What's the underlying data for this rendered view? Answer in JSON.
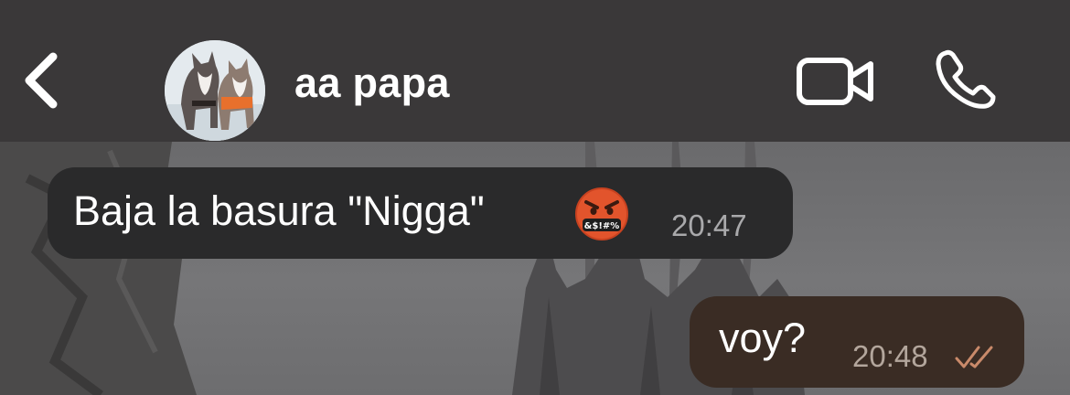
{
  "header": {
    "contact_name": "aa papa",
    "back_icon": "chevron-left-icon",
    "video_icon": "video-camera-icon",
    "call_icon": "phone-icon",
    "avatar_description": "husky dogs profile photo"
  },
  "messages": [
    {
      "direction": "incoming",
      "text": "Baja la basura \"Nigga\"",
      "emoji": "face-with-symbols-on-mouth",
      "time": "20:47"
    },
    {
      "direction": "outgoing",
      "text": "voy?",
      "time": "20:48",
      "status_icon": "double-check-icon"
    }
  ],
  "colors": {
    "header_bg": "#3a3839",
    "incoming_bubble": "#2a2a2b",
    "outgoing_bubble": "#3a2c24",
    "tick_color": "#c98a6a",
    "emoji_face": "#e2542c"
  }
}
